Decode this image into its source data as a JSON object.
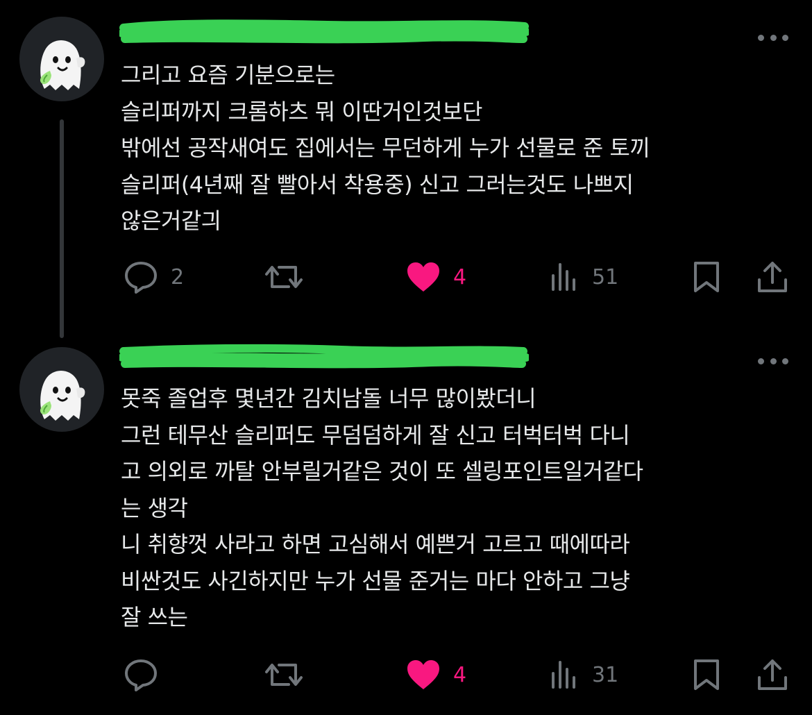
{
  "colors": {
    "background": "#000000",
    "text": "#e7e9ea",
    "secondary": "#71767b",
    "like": "#f91880",
    "redaction": "#3ddc5a"
  },
  "icons": {
    "avatar": "ghost-emoji",
    "more": "more-dots-icon",
    "reply": "reply-icon",
    "repost": "repost-icon",
    "like": "heart-filled-icon",
    "views": "views-bar-icon",
    "bookmark": "bookmark-icon",
    "share": "share-icon"
  },
  "posts": [
    {
      "username": "",
      "text": "그리고 요즘 기분으로는\n슬리퍼까지 크롬하츠 뭐 이딴거인것보단\n밖에선 공작새여도 집에서는 무던하게 누가 선물로 준 토끼\n슬리퍼(4년째 잘 빨아서 착용중) 신고 그러는것도 나쁘지\n않은거같긔",
      "replies": "2",
      "reposts": "",
      "likes": "4",
      "liked": true,
      "views": "51"
    },
    {
      "username": "",
      "text": "못죽 졸업후 몇년간 김치남돌 너무 많이봤더니\n그런 테무산 슬리퍼도 무덤덤하게 잘 신고 터벅터벅 다니\n고 의외로 까탈 안부릴거같은 것이 또 셀링포인트일거같다\n는 생각\n니 취향껏 사라고 하면 고심해서 예쁜거 고르고 때에따라\n비싼것도 사긴하지만 누가 선물 준거는 마다 안하고 그냥\n잘 쓰는",
      "replies": "",
      "reposts": "",
      "likes": "4",
      "liked": true,
      "views": "31"
    }
  ]
}
